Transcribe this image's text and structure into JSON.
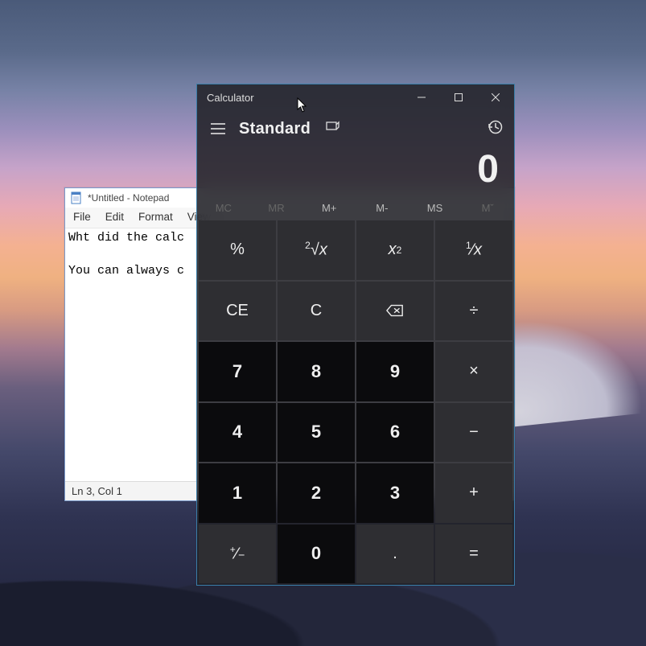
{
  "notepad": {
    "title": "*Untitled - Notepad",
    "menu": [
      "File",
      "Edit",
      "Format",
      "View"
    ],
    "content": "Wht did the calc\n\nYou can always c",
    "status": "Ln 3, Col 1"
  },
  "calc": {
    "title": "Calculator",
    "mode": "Standard",
    "display": "0",
    "memory": [
      "MC",
      "MR",
      "M+",
      "M-",
      "MS",
      "Mˇ"
    ],
    "memory_disabled": [
      true,
      true,
      false,
      false,
      false,
      true
    ],
    "keys": [
      {
        "label": "%",
        "name": "percent",
        "type": "op"
      },
      {
        "label": "²√x",
        "name": "sqrt",
        "type": "op",
        "html": true
      },
      {
        "label": "x²",
        "name": "square",
        "type": "op",
        "html": true
      },
      {
        "label": "¹⁄x",
        "name": "reciprocal",
        "type": "op",
        "html": true
      },
      {
        "label": "CE",
        "name": "clear-entry",
        "type": "op"
      },
      {
        "label": "C",
        "name": "clear",
        "type": "op"
      },
      {
        "label": "⌫",
        "name": "backspace",
        "type": "op",
        "icon": "backspace"
      },
      {
        "label": "÷",
        "name": "divide",
        "type": "op"
      },
      {
        "label": "7",
        "name": "num-7",
        "type": "num"
      },
      {
        "label": "8",
        "name": "num-8",
        "type": "num"
      },
      {
        "label": "9",
        "name": "num-9",
        "type": "num"
      },
      {
        "label": "×",
        "name": "multiply",
        "type": "op"
      },
      {
        "label": "4",
        "name": "num-4",
        "type": "num"
      },
      {
        "label": "5",
        "name": "num-5",
        "type": "num"
      },
      {
        "label": "6",
        "name": "num-6",
        "type": "num"
      },
      {
        "label": "−",
        "name": "subtract",
        "type": "op"
      },
      {
        "label": "1",
        "name": "num-1",
        "type": "num"
      },
      {
        "label": "2",
        "name": "num-2",
        "type": "num"
      },
      {
        "label": "3",
        "name": "num-3",
        "type": "num"
      },
      {
        "label": "+",
        "name": "add",
        "type": "op"
      },
      {
        "label": "⁺⁄₋",
        "name": "negate",
        "type": "op",
        "html": true
      },
      {
        "label": "0",
        "name": "num-0",
        "type": "num"
      },
      {
        "label": ".",
        "name": "decimal",
        "type": "op"
      },
      {
        "label": "=",
        "name": "equals",
        "type": "op"
      }
    ]
  }
}
